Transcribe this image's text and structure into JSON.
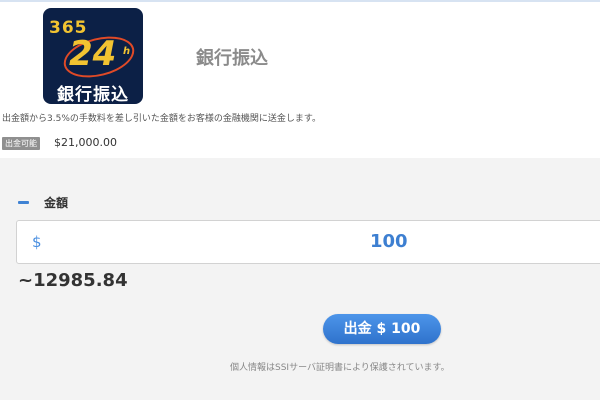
{
  "header": {
    "logo": {
      "number": "365",
      "big": "24",
      "h": "h",
      "text": "銀行振込"
    },
    "title": "銀行振込",
    "description": "出金額から3.5%の手数料を差し引いた金額をお客様の金融機関に送金します。",
    "badge": "出金可能",
    "balance": "$21,000.00"
  },
  "form": {
    "section_label": "金額",
    "currency_symbol": "$",
    "amount_value": "100",
    "converted": "~12985.84"
  },
  "actions": {
    "withdraw_button": "出金 $ 100"
  },
  "footer": {
    "secure_note": "個人情報はSSIサーバ証明書により保護されています。"
  },
  "colors": {
    "accent": "#3d7fd1",
    "logo_bg": "#0c2046",
    "logo_gold": "#f2c331",
    "logo_ring": "#e04a27"
  }
}
